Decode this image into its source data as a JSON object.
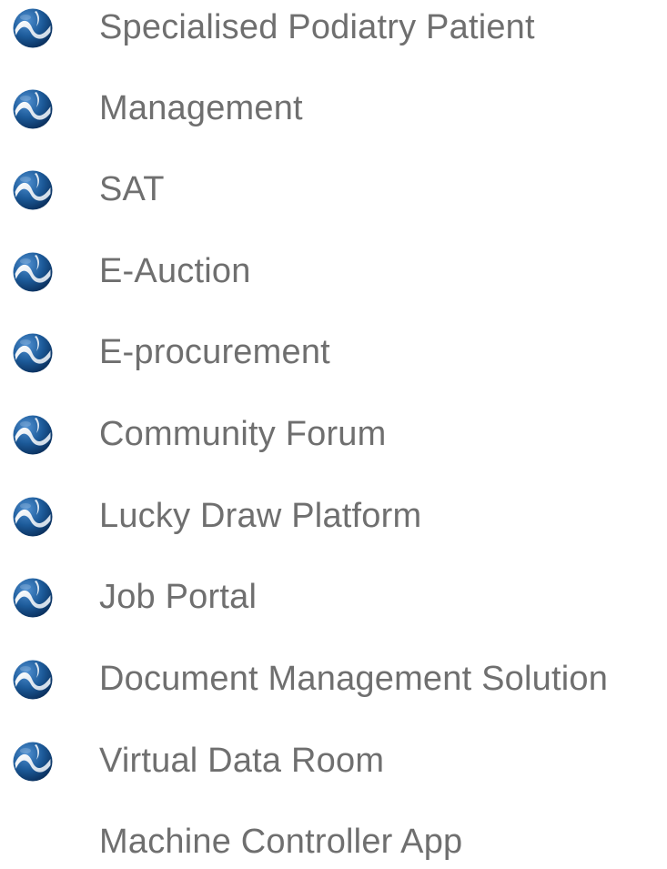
{
  "list": {
    "items": [
      {
        "label": "Specialised Podiatry Patient",
        "icon": "wave-logo-icon"
      },
      {
        "label": "Management",
        "icon": "wave-logo-icon"
      },
      {
        "label": "SAT",
        "icon": "wave-logo-icon"
      },
      {
        "label": "E-Auction",
        "icon": "wave-logo-icon"
      },
      {
        "label": "E-procurement",
        "icon": "wave-logo-icon"
      },
      {
        "label": "Community Forum",
        "icon": "wave-logo-icon"
      },
      {
        "label": "Lucky Draw Platform",
        "icon": "wave-logo-icon"
      },
      {
        "label": "Job Portal",
        "icon": "wave-logo-icon"
      },
      {
        "label": "Document Management Solution",
        "icon": "wave-logo-icon"
      },
      {
        "label": "Virtual Data Room",
        "icon": "wave-logo-icon"
      },
      {
        "label": "Machine Controller App",
        "icon": ""
      }
    ]
  },
  "colors": {
    "text": "#6f6f6f",
    "icon_dark": "#0f3f73",
    "icon_mid": "#2f6fae",
    "icon_light": "#e8eef5"
  }
}
